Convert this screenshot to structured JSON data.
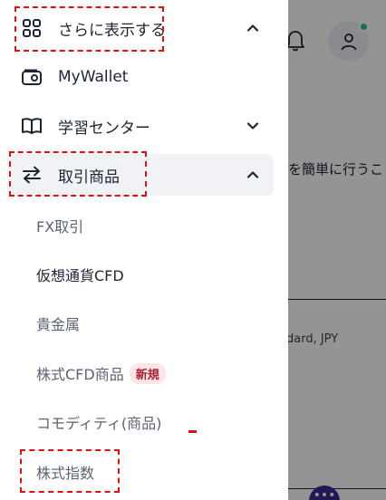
{
  "background": {
    "body_text": "を簡単に行うこ",
    "card_text": "dard, JPY",
    "fab_label": "•••"
  },
  "menu": {
    "show_more": "さらに表示する",
    "mywallet": "MyWallet",
    "learning_center": "学習センター",
    "trading_products": "取引商品"
  },
  "submenu": [
    {
      "label": "FX取引"
    },
    {
      "label": "仮想通貨CFD"
    },
    {
      "label": "貴金属"
    },
    {
      "label": "株式CFD商品",
      "badge": "新規"
    },
    {
      "label": "コモディティ(商品)"
    },
    {
      "label": "株式指数"
    }
  ],
  "colors": {
    "text": "#1d2433",
    "muted": "#5b6271",
    "badge_text": "#b01d30",
    "badge_bg": "#fde6e8",
    "highlight": "#e01010",
    "active_bg": "#f1f2f6",
    "status_dot": "#3ab78a"
  },
  "icons": [
    "grid-icon",
    "wallet-icon",
    "book-icon",
    "swap-arrows-icon",
    "chevron-up-icon",
    "chevron-down-icon",
    "bell-icon",
    "user-icon"
  ]
}
